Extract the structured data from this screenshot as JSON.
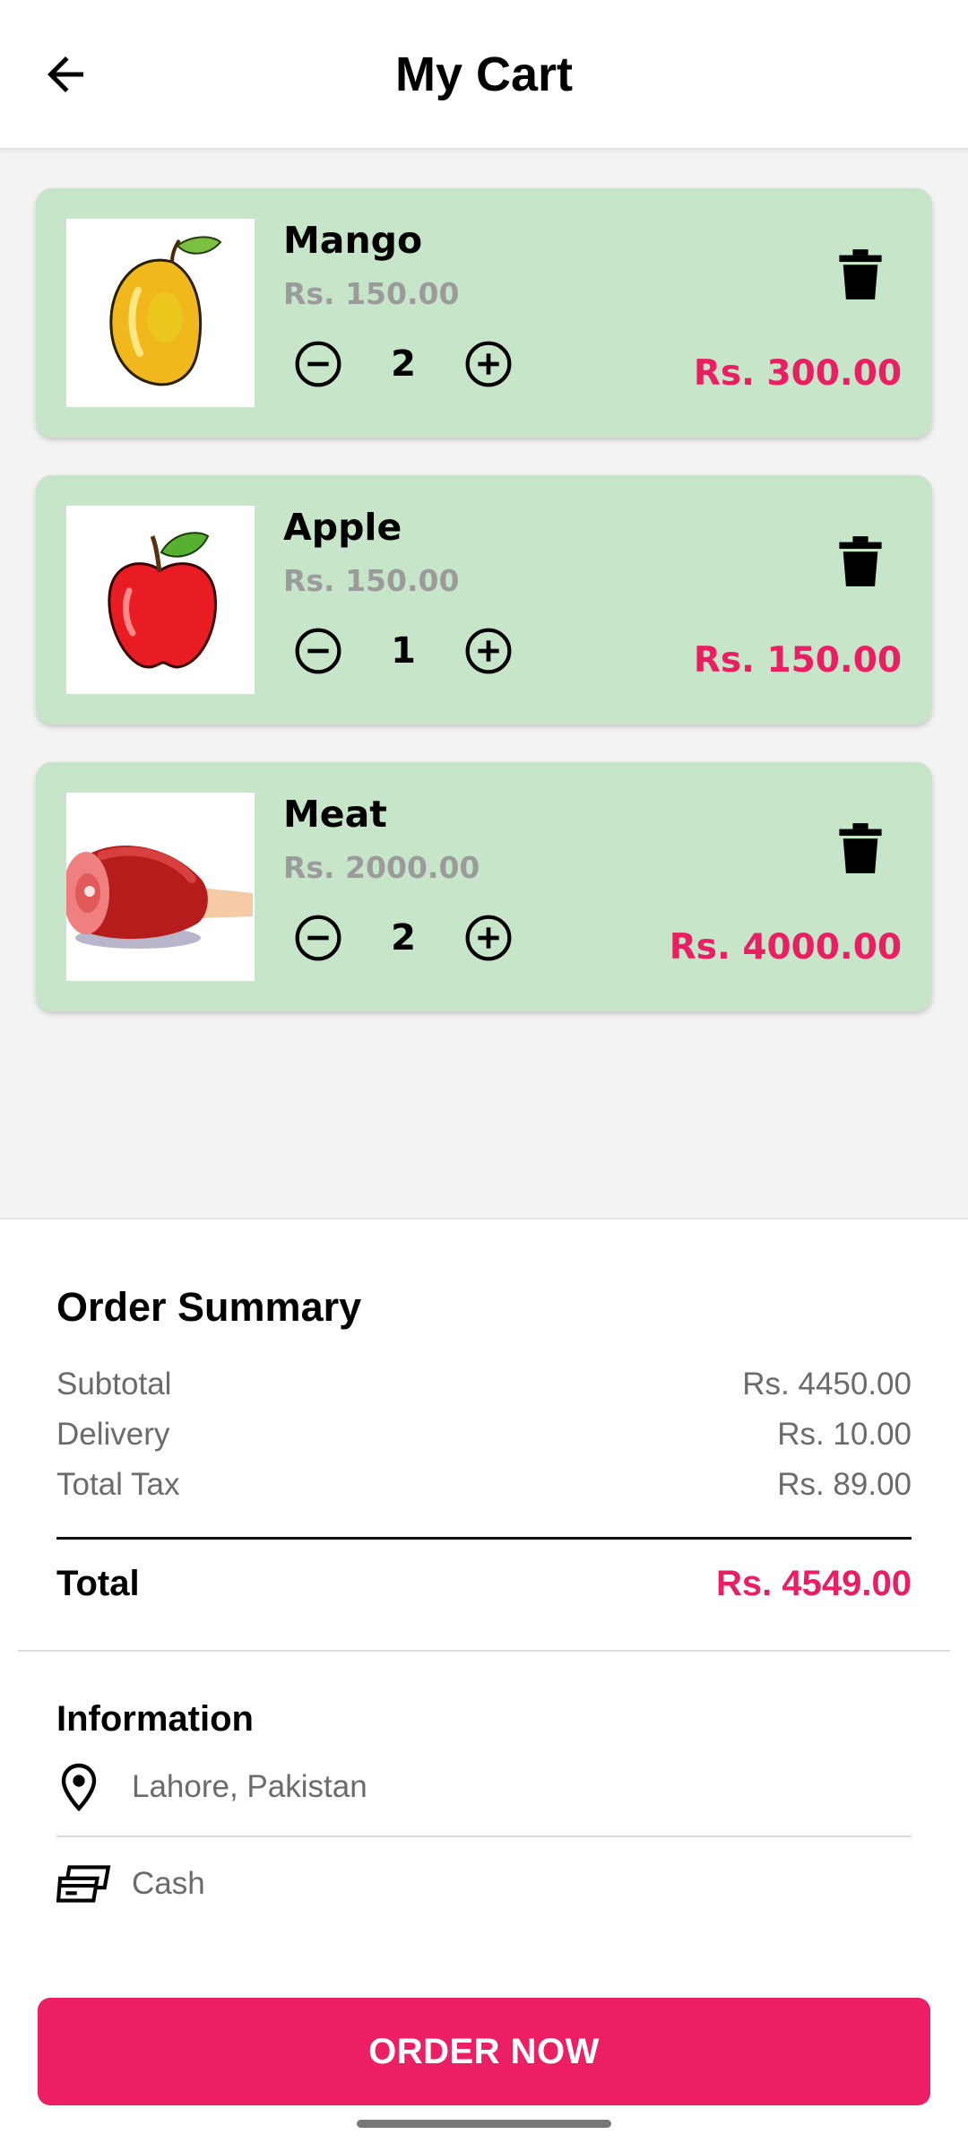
{
  "header": {
    "title": "My Cart",
    "back_icon": "arrow-left-icon"
  },
  "cart": {
    "items": [
      {
        "name": "Mango",
        "unit_price": "Rs. 150.00",
        "quantity": "2",
        "line_total": "Rs. 300.00",
        "image": "mango"
      },
      {
        "name": "Apple",
        "unit_price": "Rs. 150.00",
        "quantity": "1",
        "line_total": "Rs. 150.00",
        "image": "apple"
      },
      {
        "name": "Meat",
        "unit_price": "Rs. 2000.00",
        "quantity": "2",
        "line_total": "Rs. 4000.00",
        "image": "meat"
      }
    ]
  },
  "summary": {
    "title": "Order Summary",
    "subtotal_label": "Subtotal",
    "subtotal_value": "Rs. 4450.00",
    "delivery_label": "Delivery",
    "delivery_value": "Rs. 10.00",
    "tax_label": "Total Tax",
    "tax_value": "Rs. 89.00",
    "total_label": "Total",
    "total_value": "Rs. 4549.00"
  },
  "information": {
    "title": "Information",
    "location": "Lahore, Pakistan",
    "payment": "Cash"
  },
  "actions": {
    "order_button": "ORDER NOW"
  },
  "colors": {
    "accent": "#ec1e64",
    "card_bg": "#c7e6c9",
    "price_muted": "#9b9b9b"
  }
}
